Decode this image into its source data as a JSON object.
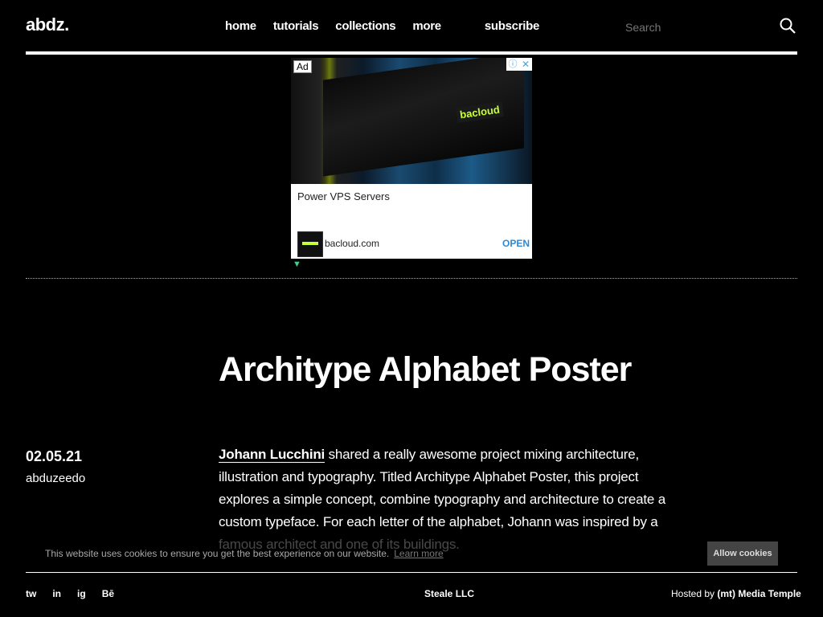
{
  "header": {
    "logo": "abdz.",
    "nav": [
      "home",
      "tutorials",
      "collections",
      "more"
    ],
    "subscribe": "subscribe",
    "search_placeholder": "Search"
  },
  "ad": {
    "badge": "Ad",
    "info_icon": "ⓘ",
    "close_icon": "✕",
    "brand": "bacloud",
    "headline": "Power VPS Servers",
    "domain": "bacloud.com",
    "cta": "OPEN",
    "mark": "▼"
  },
  "article": {
    "title": "Architype Alphabet Poster",
    "date": "02.05.21",
    "author": "abduzeedo",
    "author_link": "Johann Lucchini",
    "body": " shared a really awesome project mixing architecture, illustration and typography. Titled Architype Alphabet Poster, this project explores a simple concept, combine typography and architecture to create a custom typeface. For each letter of the alphabet, Johann was inspired by a famous architect and one of its buildings."
  },
  "cookie": {
    "text": "This website uses cookies to ensure you get the best experience on our website.",
    "link": "Learn more",
    "button": "Allow cookies"
  },
  "footer": {
    "social": [
      "tw",
      "in",
      "ig",
      "Bē"
    ],
    "copyright": "Steale LLC",
    "hosted_prefix": "Hosted by ",
    "hosted_by": "(mt) Media Temple"
  },
  "colors": {
    "background": "#000000",
    "text": "#ffffff",
    "ad_cta": "#2a8ad8",
    "ad_brand": "#c7ff3a"
  }
}
